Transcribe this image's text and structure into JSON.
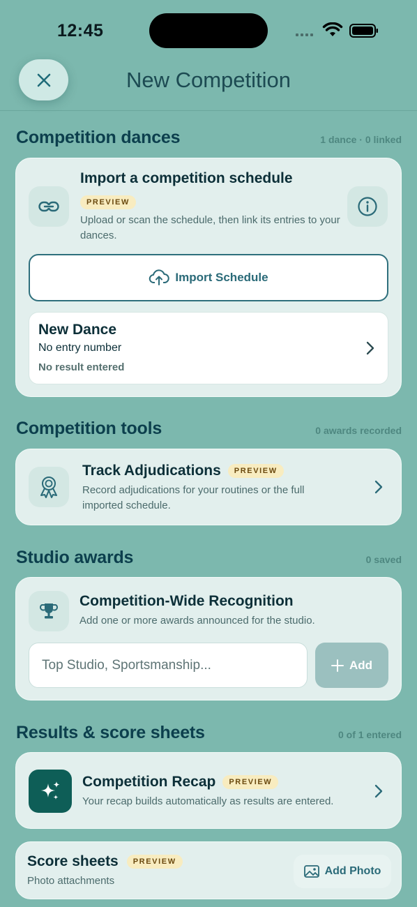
{
  "status_bar": {
    "time": "12:45"
  },
  "header": {
    "title": "New Competition",
    "close_icon": "close-icon"
  },
  "sections": {
    "dances": {
      "title": "Competition dances",
      "meta": "1 dance · 0 linked",
      "import_card": {
        "title": "Import a competition schedule",
        "badge": "PREVIEW",
        "description": "Upload or scan the schedule, then link its entries to your dances.",
        "button_label": "Import Schedule"
      },
      "dance": {
        "name": "New Dance",
        "entry": "No entry number",
        "result": "No result entered"
      }
    },
    "tools": {
      "title": "Competition tools",
      "meta": "0 awards recorded",
      "card": {
        "title": "Track Adjudications",
        "badge": "PREVIEW",
        "description": "Record adjudications for your routines or the full imported schedule."
      }
    },
    "awards": {
      "title": "Studio awards",
      "meta": "0 saved",
      "card": {
        "title": "Competition-Wide Recognition",
        "description": "Add one or more awards announced for the studio.",
        "input_placeholder": "Top Studio, Sportsmanship...",
        "input_value": "",
        "add_label": "Add"
      }
    },
    "results": {
      "title": "Results & score sheets",
      "meta": "0 of 1 entered",
      "recap": {
        "title": "Competition Recap",
        "badge": "PREVIEW",
        "description": "Your recap builds automatically as results are entered."
      },
      "score_sheets": {
        "title": "Score sheets",
        "badge": "PREVIEW",
        "subtitle": "Photo attachments",
        "button_label": "Add Photo"
      }
    }
  },
  "colors": {
    "background": "#7cb8ae",
    "card": "#e2efed",
    "accent": "#2a6a78",
    "badge_bg": "#f8ecc0",
    "recap_tile": "#0e5e57"
  }
}
